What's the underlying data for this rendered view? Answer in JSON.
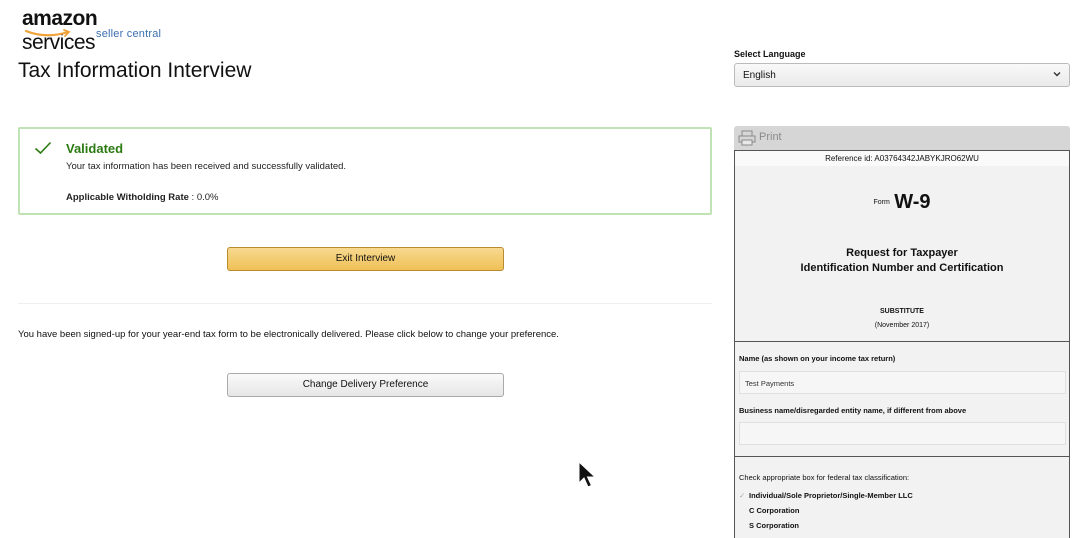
{
  "brand": {
    "logo_main": "amazon",
    "logo_services": "services",
    "logo_sub": "seller central"
  },
  "page": {
    "title": "Tax Information Interview"
  },
  "language": {
    "label": "Select Language",
    "selected": "English"
  },
  "alert": {
    "title": "Validated",
    "message": "Your tax information has been received and successfully validated.",
    "rate_label": "Applicable Witholding Rate",
    "rate_separator": " : ",
    "rate_value": "0.0%"
  },
  "actions": {
    "exit_label": "Exit Interview",
    "delivery_notice": "You have been signed-up for your year-end tax form to be electronically delivered. Please click below to change your preference.",
    "delivery_label": "Change Delivery Preference"
  },
  "form": {
    "print_label": "Print",
    "reference": "Reference id: A03764342JABYKJRO62WU",
    "form_prefix": "Form",
    "form_name": "W-9",
    "title_line1": "Request for Taxpayer",
    "title_line2": "Identification Number and Certification",
    "substitute": "SUBSTITUTE",
    "revision": "(November 2017)",
    "name_label": "Name (as shown on your income tax return)",
    "name_value": "Test Payments",
    "business_label": "Business name/disregarded entity name, if different from above",
    "business_value": "",
    "classification_label": "Check appropriate box for federal tax classification:",
    "classification_options": [
      {
        "label": "Individual/Sole Proprietor/Single-Member LLC",
        "checked": true
      },
      {
        "label": "C Corporation",
        "checked": false
      },
      {
        "label": "S Corporation",
        "checked": false
      }
    ]
  },
  "colors": {
    "validated_green": "#2b7a12",
    "alert_border": "#bfe3b4",
    "primary_button": "#efc056"
  }
}
